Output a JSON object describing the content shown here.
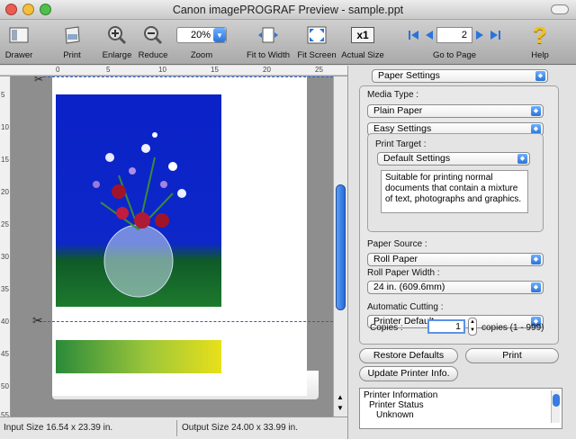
{
  "window": {
    "title": "Canon imagePROGRAF Preview - sample.ppt"
  },
  "toolbar": {
    "drawer": "Drawer",
    "print": "Print",
    "enlarge": "Enlarge",
    "reduce": "Reduce",
    "zoom_label": "Zoom",
    "zoom_value": "20%",
    "fit_width": "Fit to Width",
    "fit_screen": "Fit Screen",
    "actual_size": "Actual Size",
    "actual_size_icon": "x1",
    "go_to_page": "Go to Page",
    "page_value": "2",
    "help": "Help"
  },
  "ruler": {
    "top": [
      "0",
      "5",
      "10",
      "15",
      "20",
      "25"
    ],
    "left": [
      "5",
      "10",
      "15",
      "20",
      "25",
      "30",
      "35",
      "40",
      "45",
      "50",
      "55"
    ]
  },
  "status": {
    "input_size": "Input Size 16.54 x 23.39 in.",
    "output_size": "Output Size 24.00 x 33.99 in."
  },
  "panel": {
    "section": "Paper Settings",
    "media_type_label": "Media Type :",
    "media_type": "Plain Paper",
    "easy_settings": "Easy Settings",
    "print_target_label": "Print Target :",
    "print_target": "Default Settings",
    "description": "Suitable for printing normal documents that contain a mixture of text, photographs and graphics.",
    "paper_source_label": "Paper Source :",
    "paper_source": "Roll Paper",
    "roll_width_label": "Roll Paper Width :",
    "roll_width": "24 in. (609.6mm)",
    "auto_cut_label": "Automatic Cutting :",
    "auto_cut": "Printer Default",
    "copies_label": "Copies :",
    "copies_value": "1",
    "copies_range": "copies (1 - 999)",
    "restore_defaults": "Restore Defaults",
    "print": "Print",
    "update_printer": "Update Printer Info.",
    "info_lines": [
      "Printer Information",
      "Printer Status",
      "Unknown"
    ]
  },
  "colors": {
    "accent": "#2b73d9",
    "cut_line": "#2a5fd0"
  }
}
